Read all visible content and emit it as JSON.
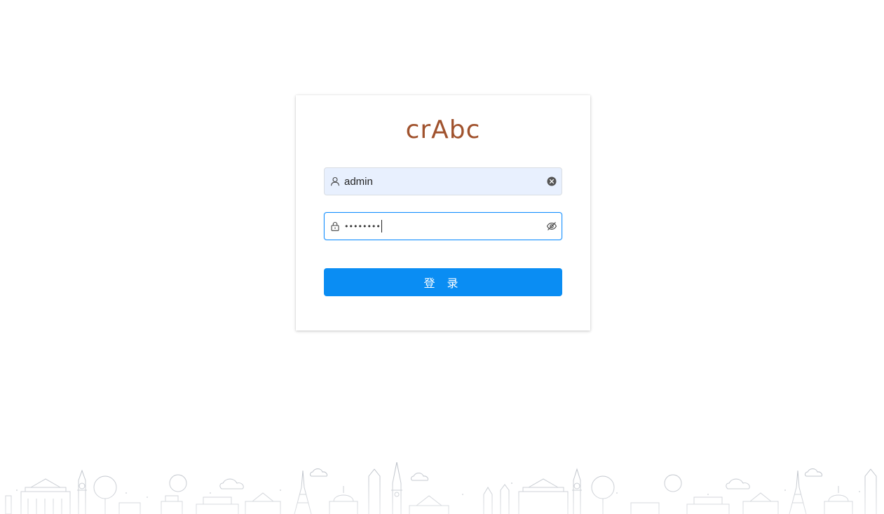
{
  "brand": {
    "logo_text": "crAbc",
    "logo_color": "#a0522d"
  },
  "login_form": {
    "username": {
      "value": "admin",
      "prefix_icon": "user-icon",
      "suffix_icon": "clear-icon"
    },
    "password": {
      "masked_value": "••••••••",
      "prefix_icon": "lock-icon",
      "suffix_icon": "eye-invisible-icon"
    },
    "submit_label": "登 录",
    "accent_color": "#0a8df3"
  },
  "footer": {
    "decoration": "city-skyline-illustration"
  }
}
